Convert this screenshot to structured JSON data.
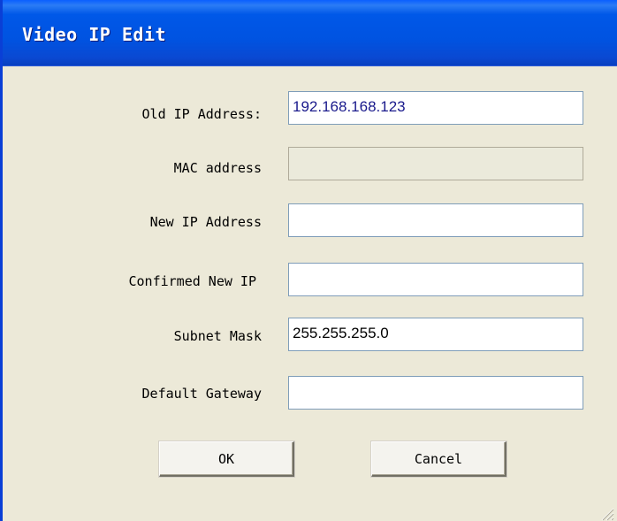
{
  "window": {
    "title": "Video IP Edit"
  },
  "form": {
    "old_ip": {
      "label": "Old IP Address:",
      "value": "192.168.168.123"
    },
    "mac": {
      "label": "MAC address",
      "value": ""
    },
    "new_ip": {
      "label": "New IP Address",
      "value": ""
    },
    "confirm_ip": {
      "label": "Confirmed New IP",
      "value": ""
    },
    "subnet": {
      "label": "Subnet Mask",
      "value": "255.255.255.0"
    },
    "gateway": {
      "label": "Default Gateway",
      "value": ""
    }
  },
  "buttons": {
    "ok": "OK",
    "cancel": "Cancel"
  },
  "colors": {
    "titlebar": "#0054e3",
    "dialog_bg": "#ece9d8",
    "field_border": "#7f9db9",
    "ip_text": "#1a1a8c"
  },
  "icons": {
    "resize_grip": "resize-grip-icon"
  }
}
